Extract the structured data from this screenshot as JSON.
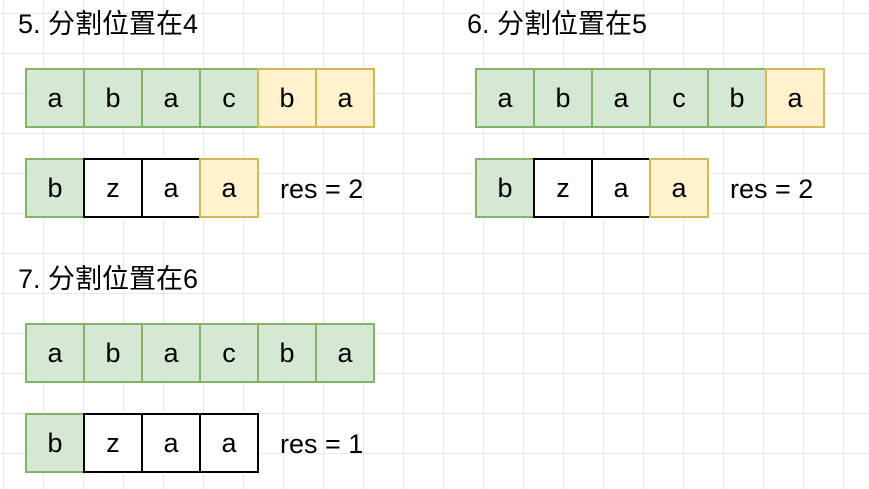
{
  "panels": [
    {
      "title": "5. 分割位置在4",
      "top_row": [
        {
          "char": "a",
          "color": "green"
        },
        {
          "char": "b",
          "color": "green"
        },
        {
          "char": "a",
          "color": "green"
        },
        {
          "char": "c",
          "color": "green"
        },
        {
          "char": "b",
          "color": "yellow"
        },
        {
          "char": "a",
          "color": "yellow"
        }
      ],
      "bottom_row": [
        {
          "char": "b",
          "color": "green"
        },
        {
          "char": "z",
          "color": "white"
        },
        {
          "char": "a",
          "color": "white"
        },
        {
          "char": "a",
          "color": "yellow"
        }
      ],
      "result": "res = 2"
    },
    {
      "title": "6. 分割位置在5",
      "top_row": [
        {
          "char": "a",
          "color": "green"
        },
        {
          "char": "b",
          "color": "green"
        },
        {
          "char": "a",
          "color": "green"
        },
        {
          "char": "c",
          "color": "green"
        },
        {
          "char": "b",
          "color": "green"
        },
        {
          "char": "a",
          "color": "yellow"
        }
      ],
      "bottom_row": [
        {
          "char": "b",
          "color": "green"
        },
        {
          "char": "z",
          "color": "white"
        },
        {
          "char": "a",
          "color": "white"
        },
        {
          "char": "a",
          "color": "yellow"
        }
      ],
      "result": "res = 2"
    },
    {
      "title": "7. 分割位置在6",
      "top_row": [
        {
          "char": "a",
          "color": "green"
        },
        {
          "char": "b",
          "color": "green"
        },
        {
          "char": "a",
          "color": "green"
        },
        {
          "char": "c",
          "color": "green"
        },
        {
          "char": "b",
          "color": "green"
        },
        {
          "char": "a",
          "color": "green"
        }
      ],
      "bottom_row": [
        {
          "char": "b",
          "color": "green"
        },
        {
          "char": "z",
          "color": "white"
        },
        {
          "char": "a",
          "color": "white"
        },
        {
          "char": "a",
          "color": "white"
        }
      ],
      "result": "res = 1"
    }
  ],
  "colors": {
    "green_fill": "#d5e8d4",
    "green_border": "#82b366",
    "yellow_fill": "#fff2cc",
    "yellow_border": "#d6b656",
    "white_fill": "#ffffff",
    "white_border": "#000000"
  }
}
